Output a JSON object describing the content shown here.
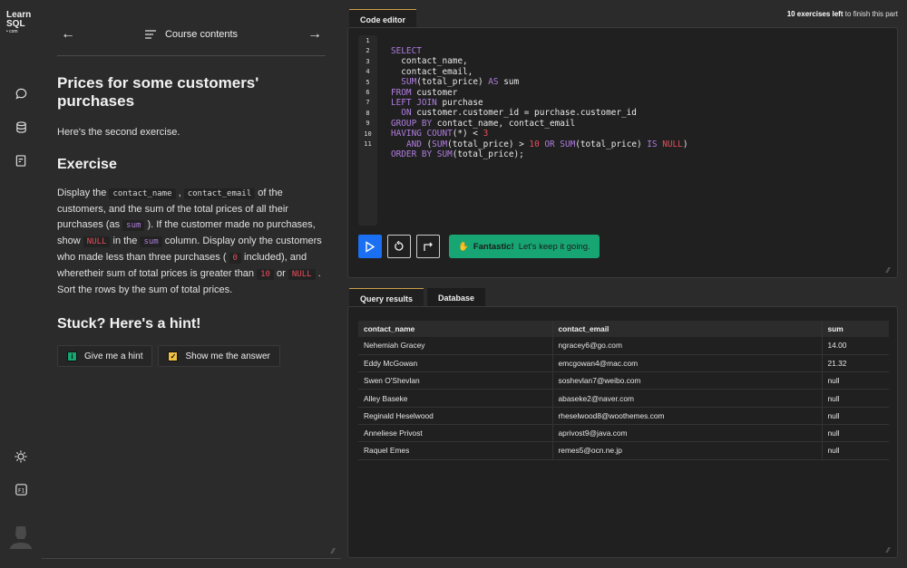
{
  "brand": {
    "line1": "Learn",
    "line2": "SQL",
    "line3": "• com"
  },
  "rail_icons": [
    "chat-icon",
    "database-icon",
    "notes-icon",
    "theme-icon",
    "shortcuts-icon",
    "user-avatar"
  ],
  "nav": {
    "prev": "←",
    "course_contents": "Course contents",
    "next": "→"
  },
  "lesson": {
    "title": "Prices for some customers' purchases",
    "intro": "Here's the second exercise.",
    "exercise_heading": "Exercise",
    "body": {
      "t1": "Display the ",
      "c1": "contact_name",
      "t2": " , ",
      "c2": "contact_email",
      "t3": " of the customers, and the sum of the total prices of all their purchases (as ",
      "c3": "sum",
      "t4": " ). If the customer made no purchases, show ",
      "c4": "NULL",
      "t5": " in the ",
      "c5": "sum",
      "t6": " column. Display only the customers who made less than three purchases ( ",
      "c6": "0",
      "t7": " included), and wheretheir sum of total prices is greater than ",
      "c7": "10",
      "t8": " or ",
      "c8": "NULL",
      "t9": " . Sort the rows by the sum of total prices."
    },
    "hint_heading": "Stuck? Here's a hint!",
    "hint_button": "Give me a hint",
    "answer_button": "Show me the answer"
  },
  "editor": {
    "tab": "Code editor",
    "progress_bold": "10 exercises left",
    "progress_rest": " to finish this part",
    "line_numbers": [
      "1",
      "2",
      "3",
      "4",
      "5",
      "6",
      "7",
      "8",
      "9",
      "10",
      "11"
    ],
    "toast_bold": "Fantastic!",
    "toast_rest": " Let's keep it going."
  },
  "results": {
    "tabs": [
      "Query results",
      "Database"
    ],
    "columns": [
      "contact_name",
      "contact_email",
      "sum"
    ],
    "rows": [
      [
        "Nehemiah Gracey",
        "ngracey6@go.com",
        "14.00"
      ],
      [
        "Eddy McGowan",
        "emcgowan4@mac.com",
        "21.32"
      ],
      [
        "Swen O'Shevlan",
        "soshevlan7@weibo.com",
        "null"
      ],
      [
        "Alley Baseke",
        "abaseke2@naver.com",
        "null"
      ],
      [
        "Reginald Heselwood",
        "rheselwood8@woothemes.com",
        "null"
      ],
      [
        "Anneliese Privost",
        "aprivost9@java.com",
        "null"
      ],
      [
        "Raquel Emes",
        "remes5@ocn.ne.jp",
        "null"
      ]
    ]
  },
  "colors": {
    "accent_run": "#1a6ff2",
    "toast": "#17a673",
    "keyword": "#b07de0",
    "number": "#e84d5a",
    "tab_accent": "#c9a24a"
  }
}
